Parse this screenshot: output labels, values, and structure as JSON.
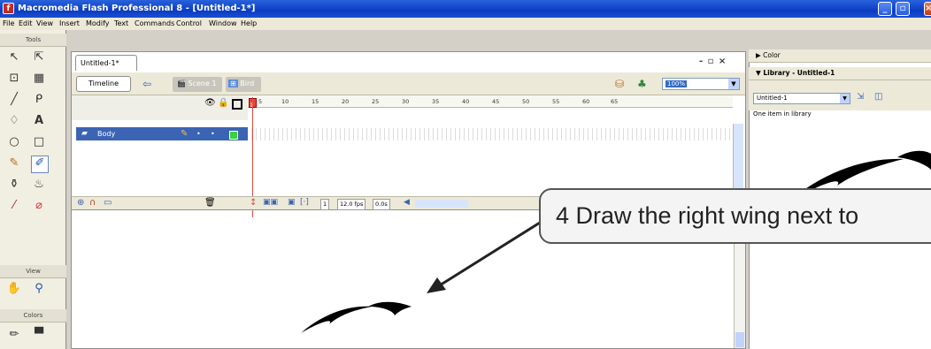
{
  "window": {
    "title": "Macromedia Flash Professional 8 - [Untitled-1*]",
    "app_icon_letter": "f"
  },
  "menubar": [
    "File",
    "Edit",
    "View",
    "Insert",
    "Modify",
    "Text",
    "Commands",
    "Control",
    "Window",
    "Help"
  ],
  "tools": {
    "title": "Tools",
    "view_label": "View",
    "colors_label": "Colors"
  },
  "document": {
    "tab_label": "Untitled-1*",
    "timeline_button": "Timeline",
    "breadcrumb": [
      "Scene 1",
      "Bird"
    ],
    "zoom": "100%",
    "window_controls": "- ▫ ×"
  },
  "timeline": {
    "frame_numbers": [
      "1",
      "5",
      "10",
      "15",
      "20",
      "25",
      "30",
      "35",
      "40",
      "45",
      "50",
      "55",
      "60",
      "65"
    ],
    "layers": [
      {
        "name": "Body"
      }
    ],
    "current_frame": "1",
    "frame_rate": "12.0 fps",
    "elapsed": "0.0s"
  },
  "panels": {
    "color_title": "Color",
    "library_title": "Library - Untitled-1",
    "library_document": "Untitled-1",
    "library_count": "One item in library"
  },
  "callout": {
    "text": "4  Draw the right wing next to"
  },
  "colors": {
    "title_bar": "#0a3cc2",
    "layer_selected": "#3c64b4",
    "playhead": "#e24a3a"
  }
}
